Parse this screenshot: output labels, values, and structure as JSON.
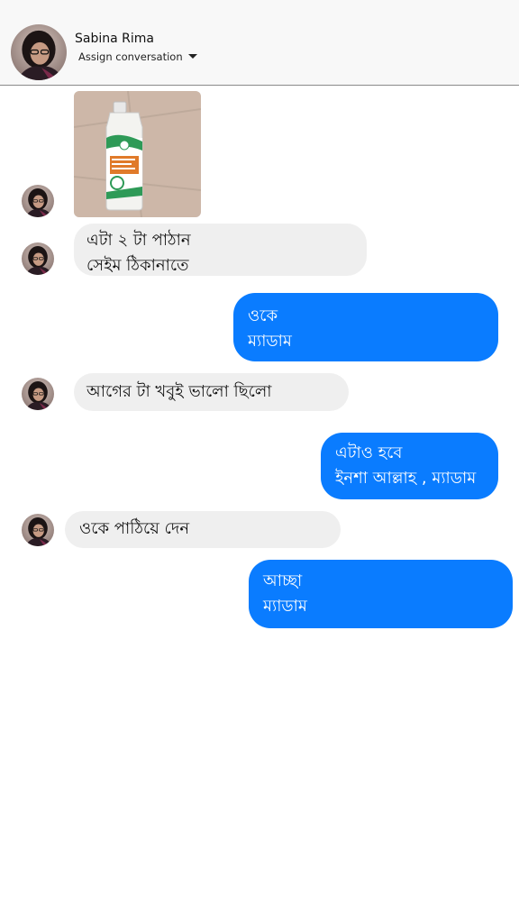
{
  "header": {
    "contact_name": "Sabina Rima",
    "assign_label": "Assign conversation",
    "avatar_icon": "profile-avatar"
  },
  "messages": [
    {
      "direction": "incoming",
      "type": "image",
      "description_icon": "product-bottle-photo"
    },
    {
      "direction": "incoming",
      "lines": [
        "এটা ২ টা পাঠান",
        "সেইম ঠিকানাতে"
      ]
    },
    {
      "direction": "outgoing",
      "lines": [
        "ওকে",
        "ম্যাডাম"
      ]
    },
    {
      "direction": "incoming",
      "lines": [
        "আগের টা খবুই ভালো ছিলো"
      ]
    },
    {
      "direction": "outgoing",
      "lines": [
        "এটাও হবে",
        "ইনশা আল্লাহ , ম্যাডাম"
      ]
    },
    {
      "direction": "incoming",
      "lines": [
        "ওকে পাঠিয়ে দেন"
      ]
    },
    {
      "direction": "outgoing",
      "lines": [
        "আচ্ছা",
        "ম্যাডাম"
      ]
    }
  ],
  "colors": {
    "outgoing_bubble": "#0a7cff",
    "incoming_bubble": "#efefef",
    "header_bg": "#f8f8f8"
  }
}
